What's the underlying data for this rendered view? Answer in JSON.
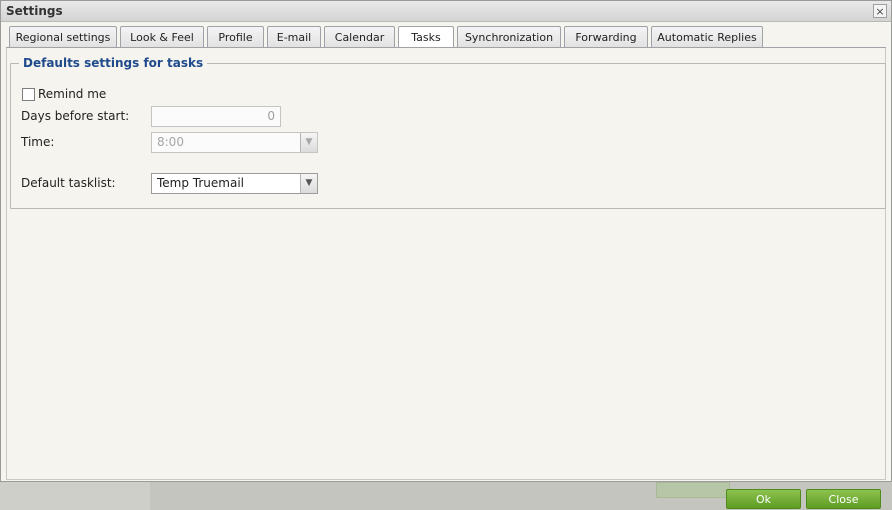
{
  "dialog": {
    "title": "Settings",
    "close_glyph": "×"
  },
  "tabs": [
    {
      "label": "Regional settings"
    },
    {
      "label": "Look & Feel"
    },
    {
      "label": "Profile"
    },
    {
      "label": "E-mail"
    },
    {
      "label": "Calendar"
    },
    {
      "label": "Tasks",
      "active": true
    },
    {
      "label": "Synchronization"
    },
    {
      "label": "Forwarding"
    },
    {
      "label": "Automatic Replies"
    }
  ],
  "section": {
    "legend": "Defaults settings for tasks",
    "remind_me_label": "Remind me",
    "remind_me_checked": false,
    "days_before_start_label": "Days before start:",
    "days_before_start_value": "0",
    "time_label": "Time:",
    "time_value": "8:00",
    "default_tasklist_label": "Default tasklist:",
    "default_tasklist_value": "Temp Truemail"
  },
  "footer": {
    "ok_label": "Ok",
    "close_label": "Close"
  },
  "colors": {
    "legend": "#1f4a8c",
    "button_green": "#6aa82d",
    "dialog_bg": "#f5f4ef"
  },
  "icons": {
    "close": "close-icon",
    "dropdown": "chevron-down-icon"
  }
}
